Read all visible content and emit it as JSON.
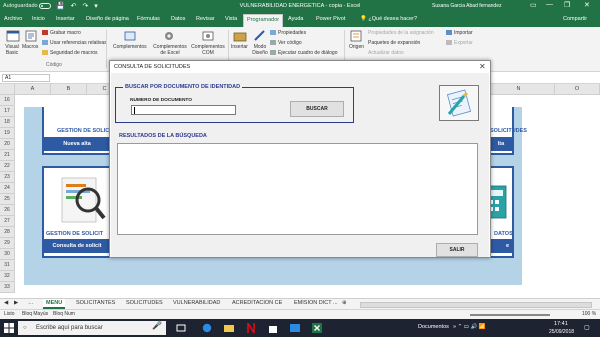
{
  "titlebar": {
    "autosave": "Autoguardado",
    "title": "VULNERABILIDAD ENERGETICA - copia  -  Excel",
    "user": "Susana Garcia Abad fernandez"
  },
  "tabs": [
    "Archivo",
    "Inicio",
    "Insertar",
    "Diseño de página",
    "Fórmulas",
    "Datos",
    "Revisar",
    "Vista",
    "Programador",
    "Ayuda",
    "Power Pivot"
  ],
  "tell_me": "¿Qué desea hacer?",
  "share": "Compartir",
  "ribbon": {
    "visual_basic": "Visual Basic",
    "macros": "Macros",
    "grabar_macro": "Grabar macro",
    "usar_referencias": "Usar referencias relativas",
    "seguridad_macros": "Seguridad de macros",
    "codigo_label": "Código",
    "complementos": "Complementos",
    "complementos_excel": "Complementos de Excel",
    "complementos_com": "Complementos COM",
    "insertar": "Insertar",
    "modo_diseno": "Modo Diseño",
    "propiedades": "Propiedades",
    "ver_codigo": "Ver código",
    "ejecutar_cuadro": "Ejecutar cuadro de diálogo",
    "origen": "Origen",
    "propiedades_asignacion": "Propiedades de la asignación",
    "paquetes_expansion": "Paquetes de expansión",
    "actualizar_datos": "Actualizar datos",
    "importar": "Importar",
    "exportar": "Exportar"
  },
  "namebox": "A1",
  "columns": [
    "A",
    "B",
    "C",
    "D",
    "E",
    "F",
    "G",
    "H",
    "I",
    "J",
    "K",
    "L",
    "M",
    "N",
    "O"
  ],
  "rows": [
    "16",
    "17",
    "18",
    "19",
    "20",
    "21",
    "22",
    "23",
    "24",
    "25",
    "26",
    "27",
    "28",
    "29",
    "30",
    "31",
    "32",
    "33",
    "34"
  ],
  "cards": {
    "gestion_solicitudes": "GESTION DE SOLICIT",
    "nueva_alta": "Nueva alta",
    "solicitudes_right": "SOLICITUDES",
    "alta_right": "lta",
    "gestion_solicitudes_2": "GESTION DE SOLICIT",
    "consulta_solicitudes": "Consulta de solicit",
    "datos_right": "DATOS",
    "btn_right": "e"
  },
  "dialog": {
    "title": "CONSULTA DE SOLICITUDES",
    "search_legend": "BUSCAR POR DOCUMENTO DE IDENTIDAD",
    "doc_label": "NUMERO DE DOCUMENTO",
    "buscar": "BUSCAR",
    "results_title": "RESULTADOS DE LA BÚSQUEDA",
    "salir": "SALIR"
  },
  "sheet_tabs": [
    "MENU",
    "SOLICITANTES",
    "SOLICITUDES",
    "VULNERABILIDAD",
    "ACREDITACION CE",
    "EMISION DICT ..."
  ],
  "status": {
    "listo": "Listo",
    "bloq_mayus": "Bloq Mayús",
    "bloq_num": "Bloq Num",
    "zoom": "100 %"
  },
  "taskbar": {
    "search_placeholder": "Escribe aquí para buscar",
    "documentos": "Documentos",
    "time": "17:41",
    "date": "25/09/2018"
  },
  "colors": {
    "excel_green": "#217346",
    "card_blue": "#2e5aa4",
    "menu_bg": "#b4d3e7"
  }
}
